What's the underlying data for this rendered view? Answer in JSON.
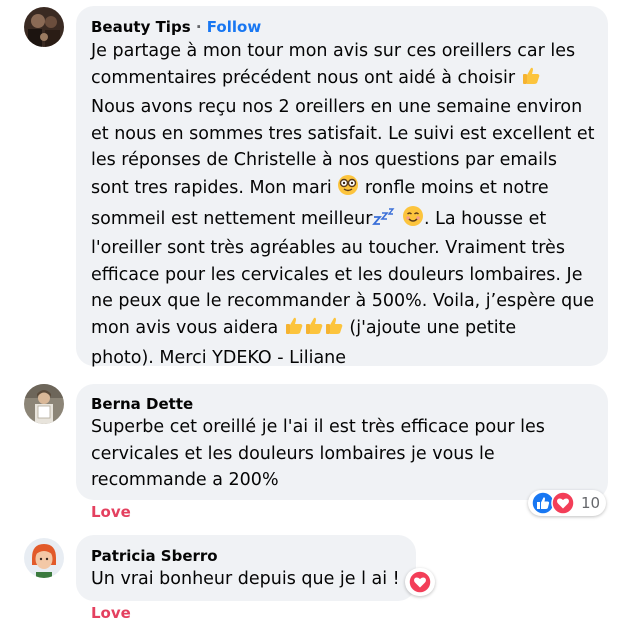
{
  "comments": [
    {
      "author": "Beauty Tips",
      "separator": "·",
      "follow_label": "Follow",
      "lines": [
        "Je partage à mon tour mon avis sur ces oreillers car les",
        "commentaires précédent nous ont aidé à choisir ",
        "Nous avons reçu nos 2 oreillers en une semaine environ",
        "et nous en sommes tres satisfait. Le suivi est excellent et",
        "les réponses de Christelle à nos questions par emails",
        "sont tres rapides. Mon mari ",
        " ronfle moins et notre",
        "sommeil est nettement meilleur",
        ". La housse et",
        "l'oreiller sont très agréables au toucher. Vraiment très",
        "efficace pour les cervicales et les douleurs lombaires. Je",
        "ne peux que le recommander à 500%. Voila, j’espère que",
        "mon avis vous aidera ",
        " (j'ajoute une petite",
        "photo). Merci YDEKO - Liliane"
      ]
    },
    {
      "author": "Berna Dette",
      "lines": [
        "Superbe cet oreillé je l'ai il est très efficace pour les",
        "cervicales et les douleurs lombaires je vous le",
        "recommande a 200%"
      ],
      "reaction_label": "Love",
      "reaction_count": "10",
      "reaction_icons": [
        "like-icon",
        "love-icon"
      ]
    },
    {
      "author": "Patricia Sberro",
      "lines": [
        "Un vrai bonheur depuis que je l ai ! "
      ],
      "reaction_label": "Love",
      "reaction_icons": [
        "love-icon"
      ]
    }
  ],
  "colors": {
    "bubble": "#f0f2f5",
    "follow": "#1877f2",
    "love": "#e4405f",
    "like": "#1877f2",
    "secondary_text": "#65676b"
  }
}
